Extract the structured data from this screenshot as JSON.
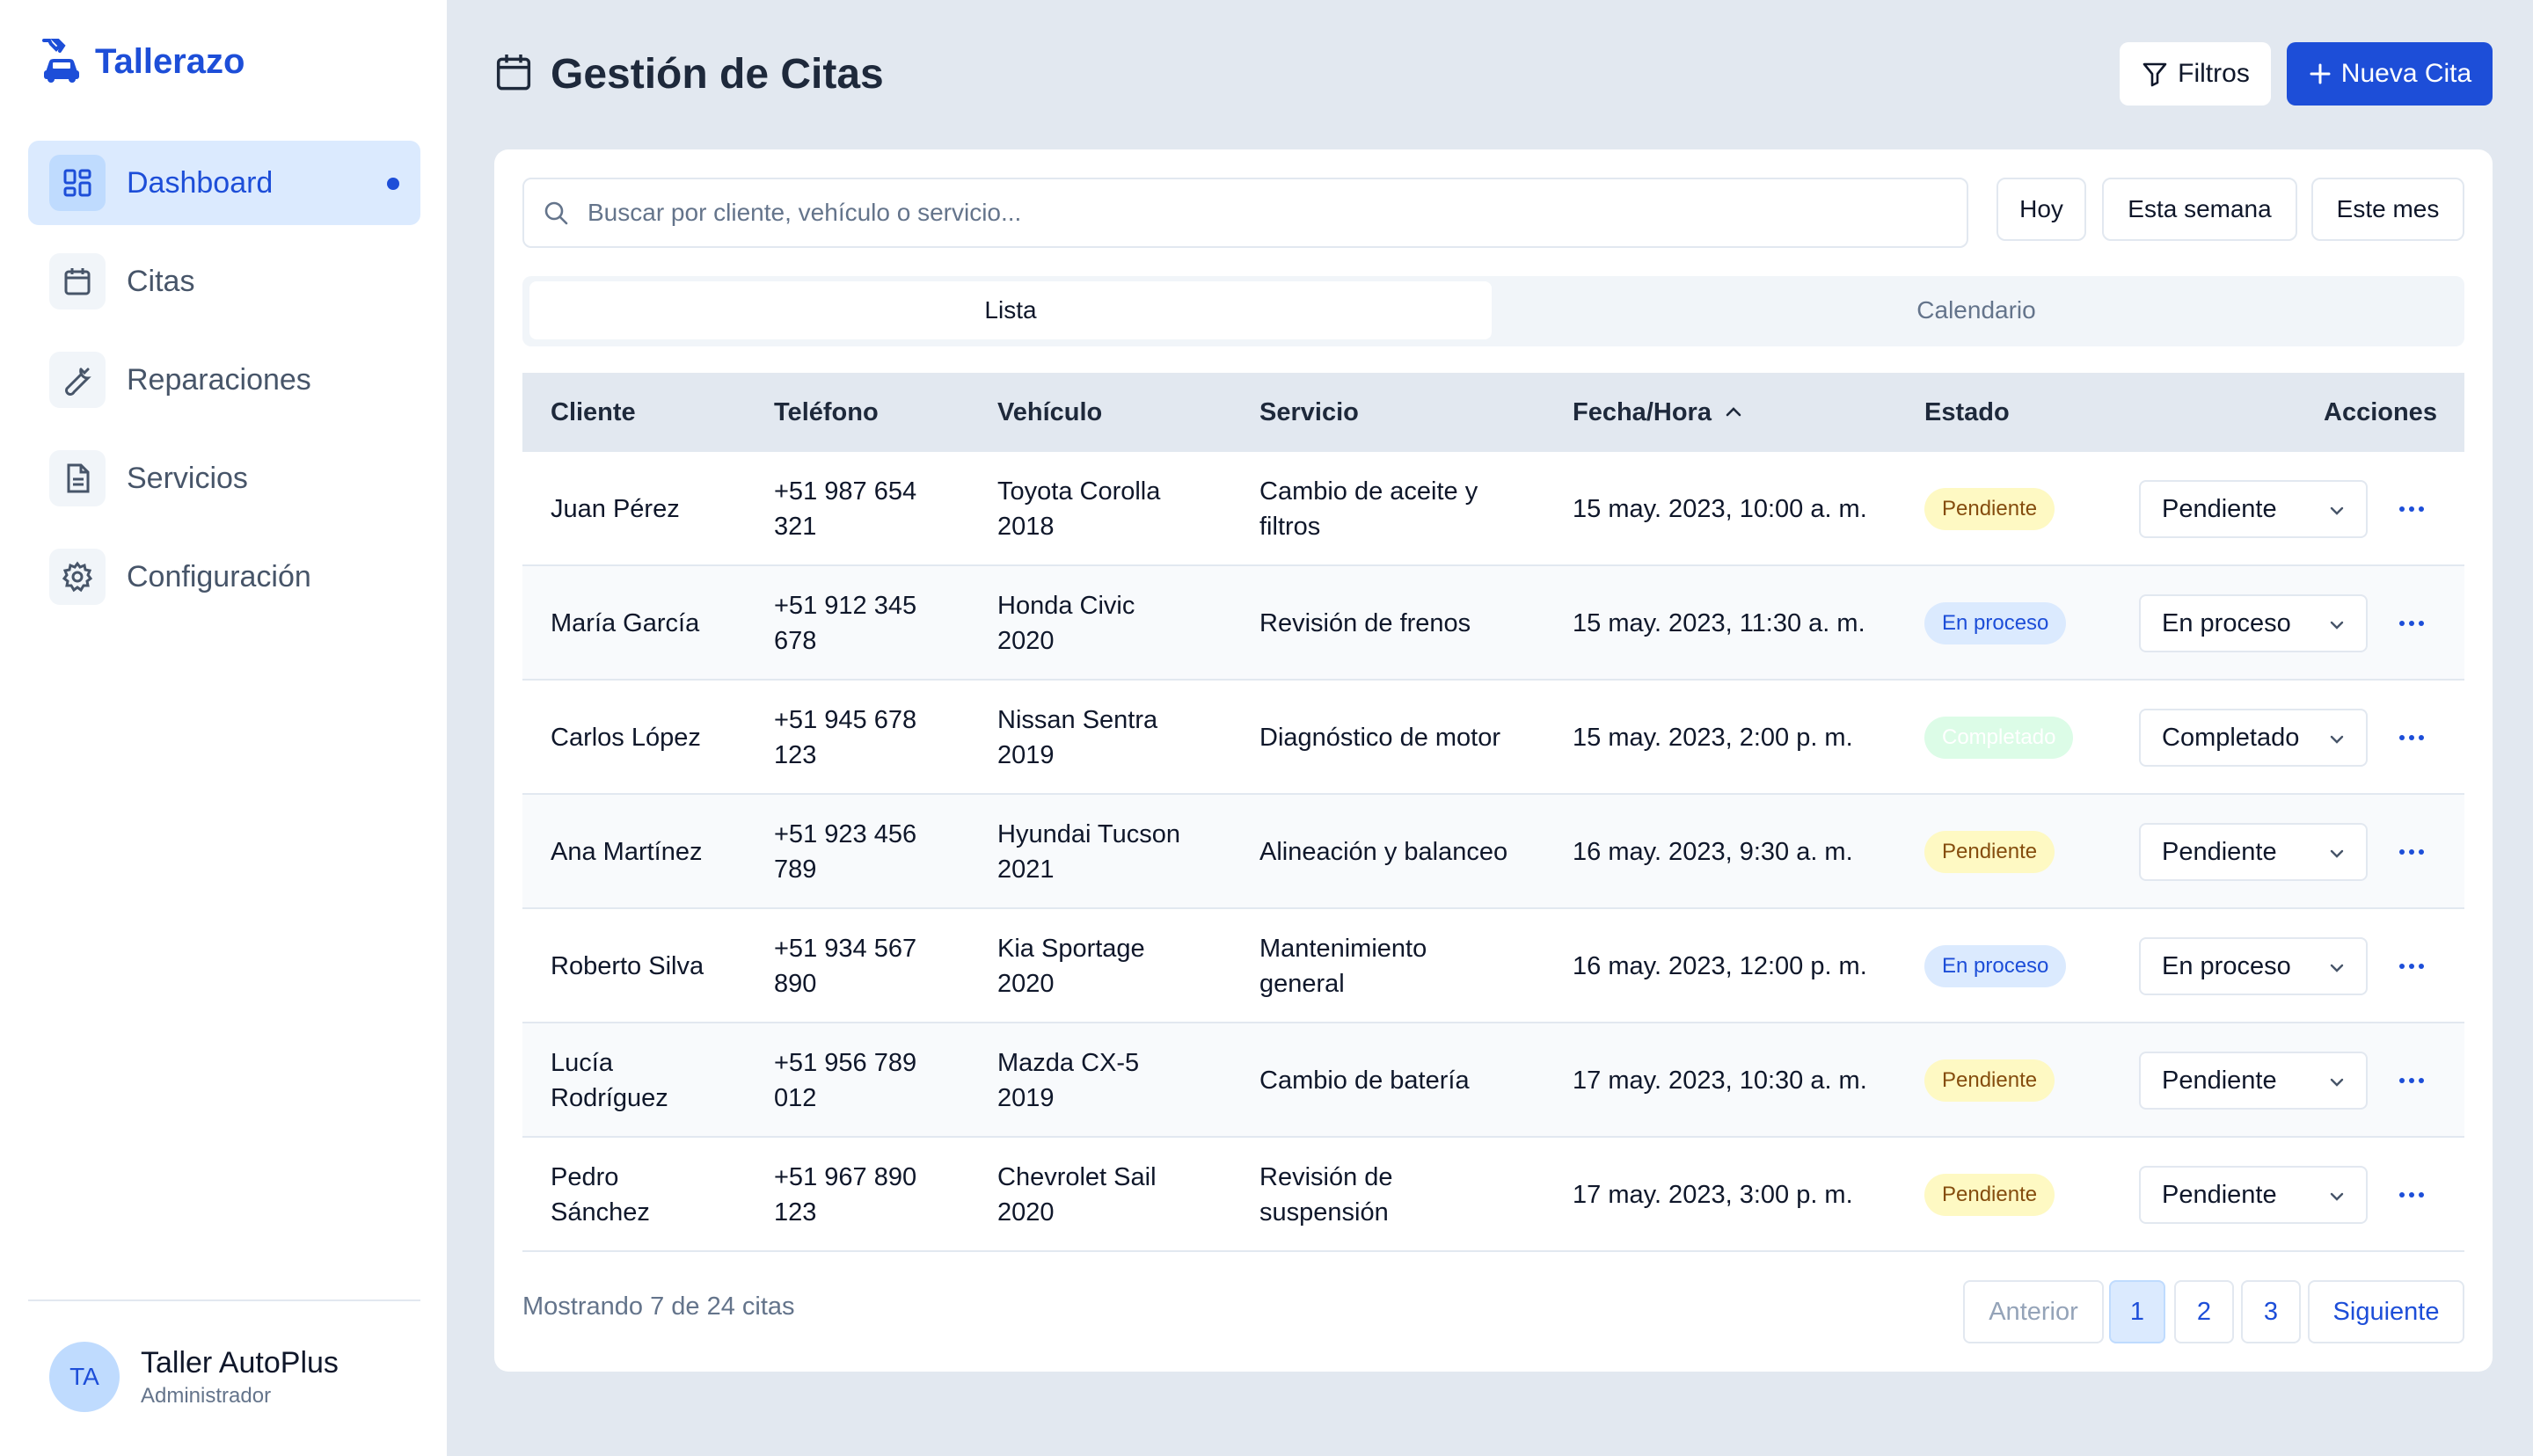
{
  "app": {
    "name": "Tallerazo",
    "logo_icon": "car-repair-icon"
  },
  "sidebar": {
    "items": [
      {
        "label": "Dashboard",
        "icon": "dashboard-icon",
        "active": true
      },
      {
        "label": "Citas",
        "icon": "calendar-icon"
      },
      {
        "label": "Reparaciones",
        "icon": "wrench-icon"
      },
      {
        "label": "Servicios",
        "icon": "document-icon"
      },
      {
        "label": "Configuración",
        "icon": "gear-icon"
      }
    ],
    "profile": {
      "initials": "TA",
      "name": "Taller AutoPlus",
      "role": "Administrador"
    }
  },
  "header": {
    "title": "Gestión de Citas",
    "filter_label": "Filtros",
    "new_label": "Nueva Cita"
  },
  "search": {
    "placeholder": "Buscar por cliente, vehículo o servicio..."
  },
  "quick_filters": [
    "Hoy",
    "Esta semana",
    "Este mes"
  ],
  "tabs": [
    {
      "label": "Lista",
      "active": true
    },
    {
      "label": "Calendario"
    }
  ],
  "table": {
    "columns": [
      "Cliente",
      "Teléfono",
      "Vehículo",
      "Servicio",
      "Fecha/Hora",
      "Estado",
      "Acciones"
    ],
    "sort_column": "Fecha/Hora",
    "sort_direction": "ascending",
    "rows": [
      {
        "cliente": "Juan Pérez",
        "telefono": [
          "+51 987 654",
          "321"
        ],
        "vehiculo": [
          "Toyota Corolla",
          "2018"
        ],
        "servicio": [
          "Cambio de aceite y",
          "filtros"
        ],
        "fecha": "15 may. 2023, 10:00 a. m.",
        "estado": "Pendiente",
        "accion": "Pendiente"
      },
      {
        "cliente": "María García",
        "telefono": [
          "+51 912 345",
          "678"
        ],
        "vehiculo": [
          "Honda Civic",
          "2020"
        ],
        "servicio": [
          "Revisión de frenos",
          ""
        ],
        "fecha": "15 may. 2023, 11:30 a. m.",
        "estado": "En proceso",
        "accion": "En proceso"
      },
      {
        "cliente": "Carlos López",
        "telefono": [
          "+51 945 678",
          "123"
        ],
        "vehiculo": [
          "Nissan Sentra",
          "2019"
        ],
        "servicio": [
          "Diagnóstico de motor",
          ""
        ],
        "fecha": "15 may. 2023, 2:00 p. m.",
        "estado": "Completado",
        "accion": "Completado"
      },
      {
        "cliente": "Ana Martínez",
        "telefono": [
          "+51 923 456",
          "789"
        ],
        "vehiculo": [
          "Hyundai Tucson",
          "2021"
        ],
        "servicio": [
          "Alineación y balanceo",
          ""
        ],
        "fecha": "16 may. 2023, 9:30 a. m.",
        "estado": "Pendiente",
        "accion": "Pendiente"
      },
      {
        "cliente": "Roberto Silva",
        "telefono": [
          "+51 934 567",
          "890"
        ],
        "vehiculo": [
          "Kia Sportage",
          "2020"
        ],
        "servicio": [
          "Mantenimiento",
          "general"
        ],
        "fecha": "16 may. 2023, 12:00 p. m.",
        "estado": "En proceso",
        "accion": "En proceso"
      },
      {
        "cliente": "Lucía\nRodríguez",
        "telefono": [
          "+51 956 789",
          "012"
        ],
        "vehiculo": [
          "Mazda CX-5",
          "2019"
        ],
        "servicio": [
          "Cambio de batería",
          ""
        ],
        "fecha": "17 may. 2023, 10:30 a. m.",
        "estado": "Pendiente",
        "accion": "Pendiente"
      },
      {
        "cliente": "Pedro\nSánchez",
        "telefono": [
          "+51 967 890",
          "123"
        ],
        "vehiculo": [
          "Chevrolet Sail",
          "2020"
        ],
        "servicio": [
          "Revisión de",
          "suspensión"
        ],
        "fecha": "17 may. 2023, 3:00 p. m.",
        "estado": "Pendiente",
        "accion": "Pendiente"
      }
    ]
  },
  "footer": {
    "showing": "Mostrando 7 de 24 citas"
  },
  "pagination": {
    "prev": "Anterior",
    "pages": [
      "1",
      "2",
      "3"
    ],
    "current": "1",
    "next": "Siguiente"
  },
  "colors": {
    "accent": "#1d4ed8",
    "background": "#e2e8f0",
    "pending": "#fef9c3",
    "in_progress": "#dbeafe",
    "completed": "#dcfce7"
  }
}
